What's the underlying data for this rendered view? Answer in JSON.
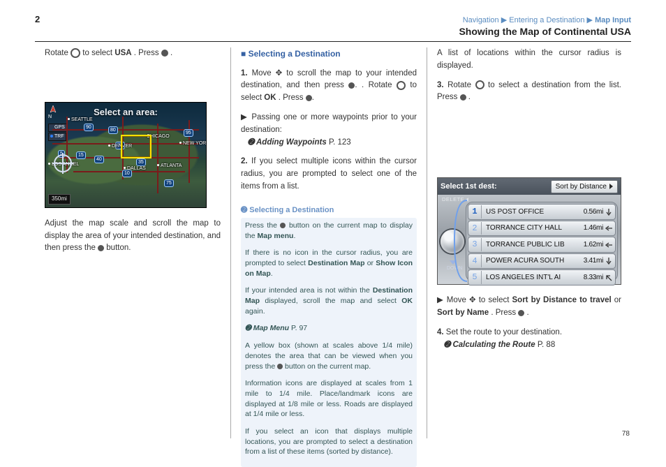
{
  "header": {
    "section_num": "2",
    "breadcrumb": [
      "Navigation",
      "Entering a Destination",
      "Map Input"
    ],
    "title": "Showing the Map of Continental USA"
  },
  "footer": {
    "page": "78"
  },
  "map_figure": {
    "title": "Select an area:",
    "compass": "N",
    "chips": [
      {
        "dot_color": "#35c566",
        "label": "GPS"
      },
      {
        "dot_color": "#2e7fff",
        "label": "TRF"
      }
    ],
    "scale": "350mi",
    "shields": [
      "5",
      "80",
      "70",
      "90",
      "40",
      "10",
      "15",
      "95",
      "75",
      "35"
    ],
    "cities": [
      "SEATTLE",
      "CHICAGO",
      "DENVER",
      "DALLAS",
      "ATLANTA",
      "NEW YORK",
      "LOS ANGEL",
      "5"
    ]
  },
  "nav_figure": {
    "title": "Select 1st dest:",
    "sort_button": "Sort by Distance",
    "delete_label": "DELETE",
    "down_label": "DOWN",
    "items": [
      {
        "idx": "1",
        "name": "US POST OFFICE",
        "dist": "0.56mi",
        "dir": "down"
      },
      {
        "idx": "2",
        "name": "TORRANCE CITY HALL",
        "dist": "1.46mi",
        "dir": "left"
      },
      {
        "idx": "3",
        "name": "TORRANCE PUBLIC LIB",
        "dist": "1.62mi",
        "dir": "left"
      },
      {
        "idx": "4",
        "name": "POWER ACURA SOUTH",
        "dist": "3.41mi",
        "dir": "down"
      },
      {
        "idx": "5",
        "name": "LOS ANGELES INT'L AI",
        "dist": "8.33mi",
        "dir": "upleft"
      }
    ]
  },
  "col1": {
    "p1_pre": "Rotate ",
    "p1_icon_alt": "dial-icon",
    "p1_mid": " to select ",
    "p1_b": "USA",
    "p1_post": ". Press ",
    "p1_icon2_alt": "enter-icon",
    "p1_end": ".",
    "caption": "Adjust the map scale and scroll the map to display the area of your intended destination, and then press the ",
    "caption_icon_alt": "enter-icon",
    "caption_end": " button."
  },
  "col2": {
    "subtitle": "■ Selecting a Destination",
    "intro_a": "Move ",
    "intro_b": " to scroll the map to your intended destination, and then press ",
    "intro_c": ". Rotate ",
    "intro_d": " to select ",
    "intro_e": ". Press ",
    "ok_label": "OK",
    "bullet_pass": "Passing one or more waypoints prior to your destination:",
    "see_add_wp": "Adding Waypoints",
    "see_add_wp_page": "P. 123",
    "p2": "If you select multiple icons within the cursor radius, you are prompted to select one of the items from a list.",
    "note_head": "Selecting a Destination",
    "note_l1": "Press the ",
    "note_l1_icon": "enter-icon",
    "note_l1_b": " button on the current map to display the ",
    "note_l1_menu": "Map menu",
    "note_l1_c": ".",
    "note_l2a": "If there is no icon in the cursor radius, you are prompted to select ",
    "note_l2_b": "Destination Map",
    "note_l2c": " or ",
    "note_l2_d": "Show Icon on Map",
    "note_l2e": ".",
    "note_l3a": "If your intended area is not within the ",
    "note_l3_b": "Destination Map",
    "note_l3c": " displayed, scroll the map and select ",
    "note_l3_d": "OK",
    "note_l3e": " again.",
    "see_map_menu": "Map Menu",
    "see_map_menu_page": "P. 97",
    "note_bot_a": "A yellow box (shown at scales above 1/4 mile) denotes the area that can be viewed when you press the ",
    "note_bot_icon": "enter-icon",
    "note_bot_b": " button on the current map.",
    "note_bot2_a": "Information icons are displayed at scales from 1 mile to 1/4 mile. Place/landmark icons are displayed at 1/8 mile or less. Roads are displayed at 1/4 mile or less.",
    "note_bot3_a": "If you select an icon that displays multiple locations, you are prompted to select a destination from a list of these items (sorted by distance)."
  },
  "col3": {
    "p1": "A list of locations within the cursor radius is displayed.",
    "p2_a": "Rotate ",
    "p2_b": " to select a destination from the list. Press ",
    "p2_c": ".",
    "p3_a": "Move ",
    "p3_b": " to select ",
    "p3_bold": "Sort by Distance to travel",
    "p3_c": " or ",
    "p3_bold2": "Sort by Name",
    "p3_d": ". Press ",
    "p3_e": ".",
    "p4_a": "Set the route to your destination.",
    "see_route": "Calculating the Route",
    "see_route_page": "P. 88"
  }
}
